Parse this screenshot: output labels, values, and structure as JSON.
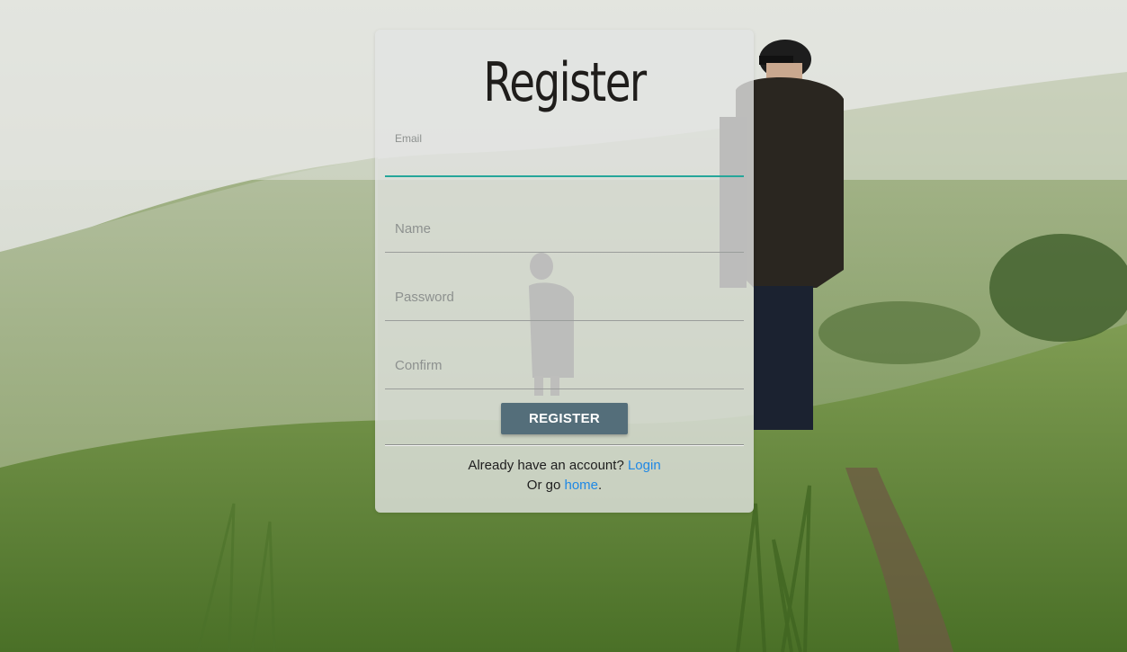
{
  "register_form": {
    "title": "Register",
    "fields": {
      "email": {
        "label": "Email",
        "value": ""
      },
      "name": {
        "label": "Name",
        "value": ""
      },
      "password": {
        "label": "Password",
        "value": ""
      },
      "confirm": {
        "label": "Confirm",
        "value": ""
      }
    },
    "submit_label": "REGISTER",
    "login_prompt": "Already have an account?",
    "login_link": "Login",
    "home_prompt": "Or go",
    "home_link": "home",
    "home_suffix": "."
  },
  "colors": {
    "accent_underline": "#26a69a",
    "button_bg": "#546e7a",
    "link": "#1e88e5"
  }
}
